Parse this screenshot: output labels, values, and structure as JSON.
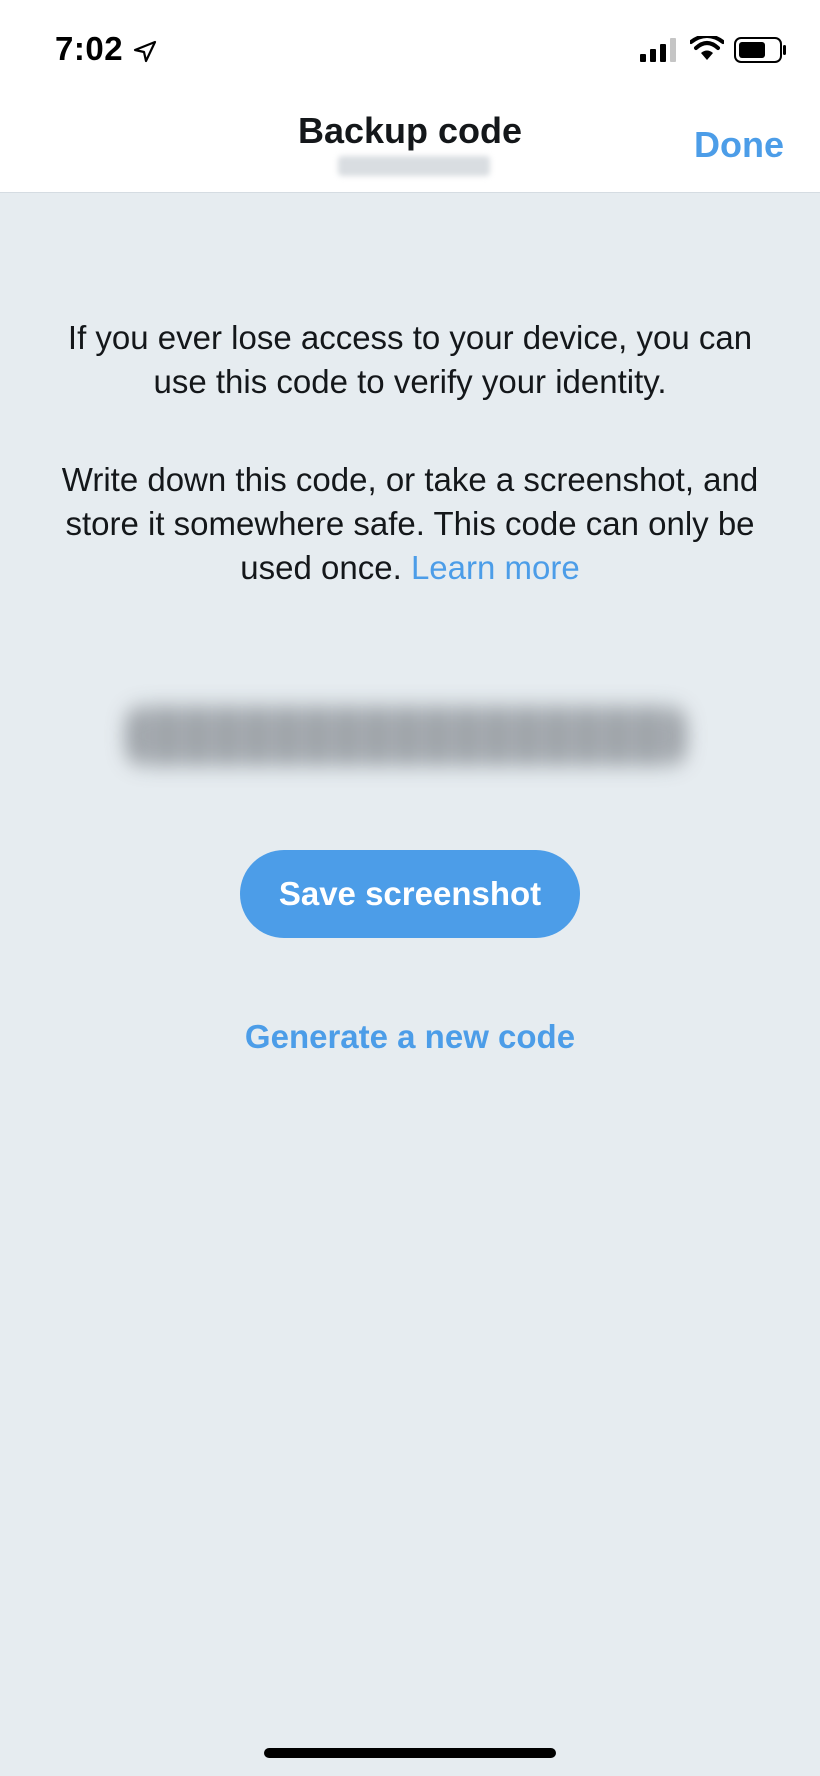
{
  "status_bar": {
    "time": "7:02",
    "icons": [
      "location-arrow-icon",
      "cellular-signal-icon",
      "wifi-icon",
      "battery-icon"
    ]
  },
  "nav": {
    "title": "Backup code",
    "done_label": "Done"
  },
  "content": {
    "intro": "If you ever lose access to your device, you can use this code to verify your identity.",
    "instructions": "Write down this code, or take a screenshot, and store it somewhere safe. This code can only be used once.",
    "learn_more_label": "Learn more",
    "save_screenshot_label": "Save screenshot",
    "generate_new_code_label": "Generate a new code"
  },
  "colors": {
    "accent": "#4c9de8",
    "background": "#e6ecf0",
    "text": "#14171a"
  }
}
